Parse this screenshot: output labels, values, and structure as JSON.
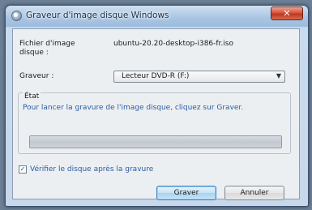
{
  "window": {
    "title": "Graveur d'image disque Windows",
    "close_label": "✕"
  },
  "form": {
    "file_label": "Fichier d'image disque :",
    "file_value": "ubuntu-20.20-desktop-i386-fr.iso",
    "drive_label": "Graveur :",
    "drive_selected": "Lecteur DVD-R (F:)"
  },
  "status": {
    "title": "État",
    "message": "Pour lancer la gravure de l'image disque, cliquez sur Graver.",
    "progress_fraction": 0
  },
  "verify": {
    "label": "Vérifier le disque après la gravure",
    "checked": true
  },
  "buttons": {
    "burn": "Graver",
    "cancel": "Annuler"
  },
  "icons": {
    "title": "disc-burner-icon",
    "dropdown": "chevron-down-icon",
    "check": "checkmark-icon"
  }
}
